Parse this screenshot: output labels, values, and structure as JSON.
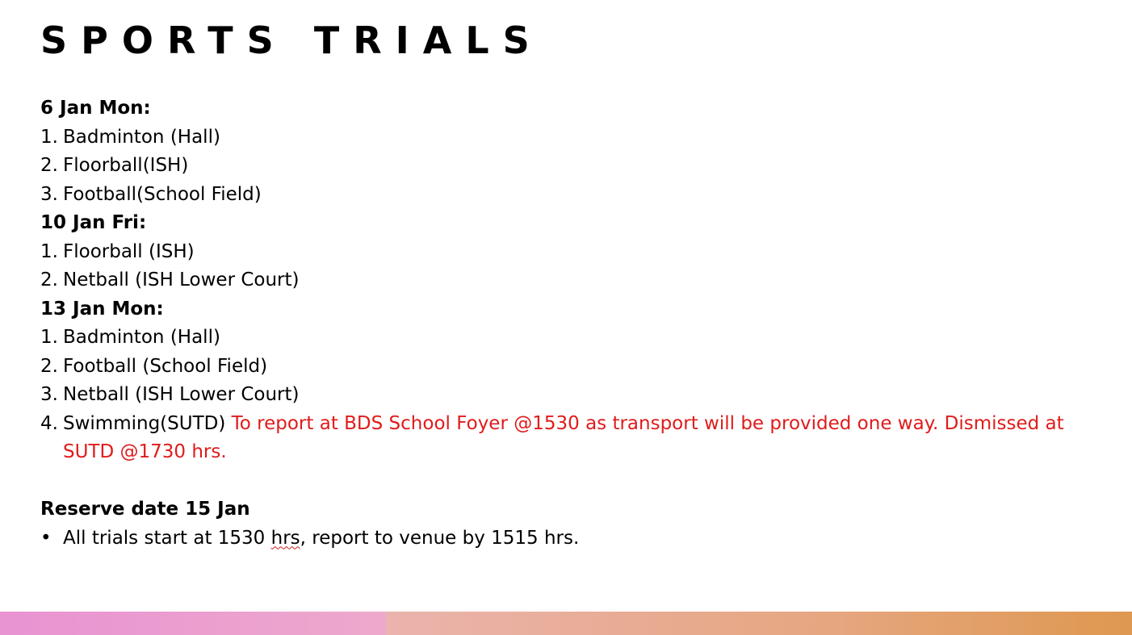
{
  "title": "SPORTS TRIALS",
  "sections": [
    {
      "heading": "6 Jan Mon:",
      "items": [
        {
          "num": "1.",
          "text": "Badminton (Hall)"
        },
        {
          "num": "2.",
          "text": "Floorball(ISH)"
        },
        {
          "num": "3.",
          "text": "Football(School Field)"
        }
      ]
    },
    {
      "heading": "10 Jan Fri:",
      "items": [
        {
          "num": "1.",
          "text": "Floorball (ISH)"
        },
        {
          "num": "2.",
          "text": "Netball (ISH Lower Court)"
        }
      ]
    },
    {
      "heading": "13 Jan Mon:",
      "items": [
        {
          "num": "1.",
          "text": "Badminton (Hall)"
        },
        {
          "num": "2.",
          "text": "Football (School Field)"
        },
        {
          "num": "3.",
          "text": "Netball (ISH Lower Court)"
        },
        {
          "num": "4.",
          "text": "Swimming(SUTD)",
          "note": "To report at BDS School Foyer @1530 as transport will be provided one way. Dismissed at SUTD @1730 hrs."
        }
      ]
    }
  ],
  "reserve": {
    "heading": "Reserve date 15 Jan",
    "bullet": "•",
    "text_before": "All trials start at 1530 ",
    "text_flagged": "hrs",
    "text_after": ", report to venue by 1515 hrs."
  },
  "colors": {
    "note_red": "#e01b1b",
    "bar_pink": "#e993d2",
    "bar_orange": "#de9850"
  }
}
